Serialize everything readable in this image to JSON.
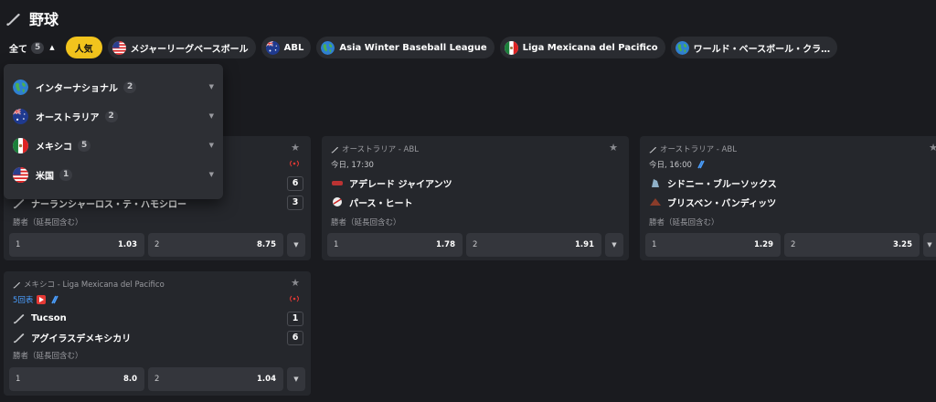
{
  "header": {
    "title": "野球",
    "icon": "baseball-bat-icon"
  },
  "filters": {
    "all_label": "全て",
    "all_count": "5",
    "popular_label": "人気",
    "chips": [
      {
        "label": "メジャーリーグベースボール",
        "icon": "flag-us-icon"
      },
      {
        "label": "ABL",
        "icon": "flag-au-icon"
      },
      {
        "label": "Asia Winter Baseball League",
        "icon": "globe-icon"
      },
      {
        "label": "Liga Mexicana del Pacifico",
        "icon": "flag-mx-icon"
      },
      {
        "label": "ワールド・ベースボール・クラ…",
        "icon": "globe-icon"
      }
    ]
  },
  "dropdown": {
    "items": [
      {
        "label": "インターナショナル",
        "count": "2",
        "icon": "globe-icon"
      },
      {
        "label": "オーストラリア",
        "count": "2",
        "icon": "flag-au-icon"
      },
      {
        "label": "メキシコ",
        "count": "5",
        "icon": "flag-mx-icon"
      },
      {
        "label": "米国",
        "count": "1",
        "icon": "flag-us-icon"
      }
    ]
  },
  "cards": [
    {
      "league": "",
      "team1": "",
      "team2": "ナーランシャーロス・テ・ハモシロー",
      "score1": "6",
      "score2": "3",
      "market": "勝者（延長回含む）",
      "odds": [
        {
          "label": "1",
          "value": "1.03"
        },
        {
          "label": "2",
          "value": "8.75"
        }
      ]
    },
    {
      "league": "オーストラリア - ABL",
      "time": "今日, 17:30",
      "team1": "アデレード ジャイアンツ",
      "team2": "パース・ヒート",
      "market": "勝者（延長回含む）",
      "odds": [
        {
          "label": "1",
          "value": "1.78"
        },
        {
          "label": "2",
          "value": "1.91"
        }
      ]
    },
    {
      "league": "オーストラリア - ABL",
      "time": "今日, 16:00",
      "team1": "シドニー・ブルーソックス",
      "team2": "ブリスベン・バンディッツ",
      "market": "勝者（延長回含む）",
      "odds": [
        {
          "label": "1",
          "value": "1.29"
        },
        {
          "label": "2",
          "value": "3.25"
        }
      ]
    },
    {
      "league": "メキシコ - Liga Mexicana del Pacifico",
      "time": "5回表",
      "team1": "Tucson",
      "team2": "アグイラスデメキシカリ",
      "score1": "1",
      "score2": "6",
      "market": "勝者（延長回含む）",
      "odds": [
        {
          "label": "1",
          "value": "8.0"
        },
        {
          "label": "2",
          "value": "1.04"
        }
      ]
    }
  ],
  "colors": {
    "background": "#1a1b1f",
    "card": "#25272c",
    "accent_yellow": "#f2c41d",
    "live_blue": "#4a9eff",
    "live_red": "#e53935"
  }
}
